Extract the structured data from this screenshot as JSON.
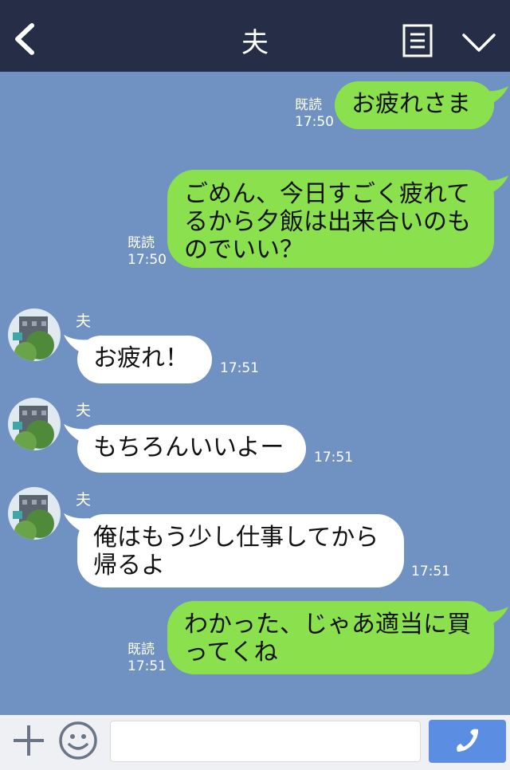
{
  "header": {
    "title": "夫",
    "icons": [
      "back-icon",
      "notes-icon",
      "chevron-down-icon"
    ]
  },
  "messages": [
    {
      "dir": "out",
      "read": "既読",
      "time": "17:50",
      "text": "お疲れさま"
    },
    {
      "dir": "out",
      "read": "既読",
      "time": "17:50",
      "lines": [
        "ごめん、今日すごく疲れて",
        "るから夕飯は出来合いのも",
        "のでいい？"
      ]
    },
    {
      "dir": "in",
      "sender": "夫",
      "time": "17:51",
      "text": "お疲れ！"
    },
    {
      "dir": "in",
      "sender": "夫",
      "time": "17:51",
      "text": "もちろんいいよー"
    },
    {
      "dir": "in",
      "sender": "夫",
      "time": "17:51",
      "lines": [
        "俺はもう少し仕事してから",
        "帰るよ"
      ]
    },
    {
      "dir": "out",
      "read": "既読",
      "time": "17:51",
      "lines": [
        "わかった、じゃあ適当に買",
        "ってくね"
      ]
    }
  ],
  "footer": {
    "icons": [
      "plus-icon",
      "smile-icon",
      "phone-icon"
    ],
    "input_placeholder": ""
  },
  "colors": {
    "background": "#7092c2",
    "header": "#252e46",
    "outgoing": "#8be04e",
    "incoming": "#ffffff",
    "call": "#5b8ee2"
  }
}
